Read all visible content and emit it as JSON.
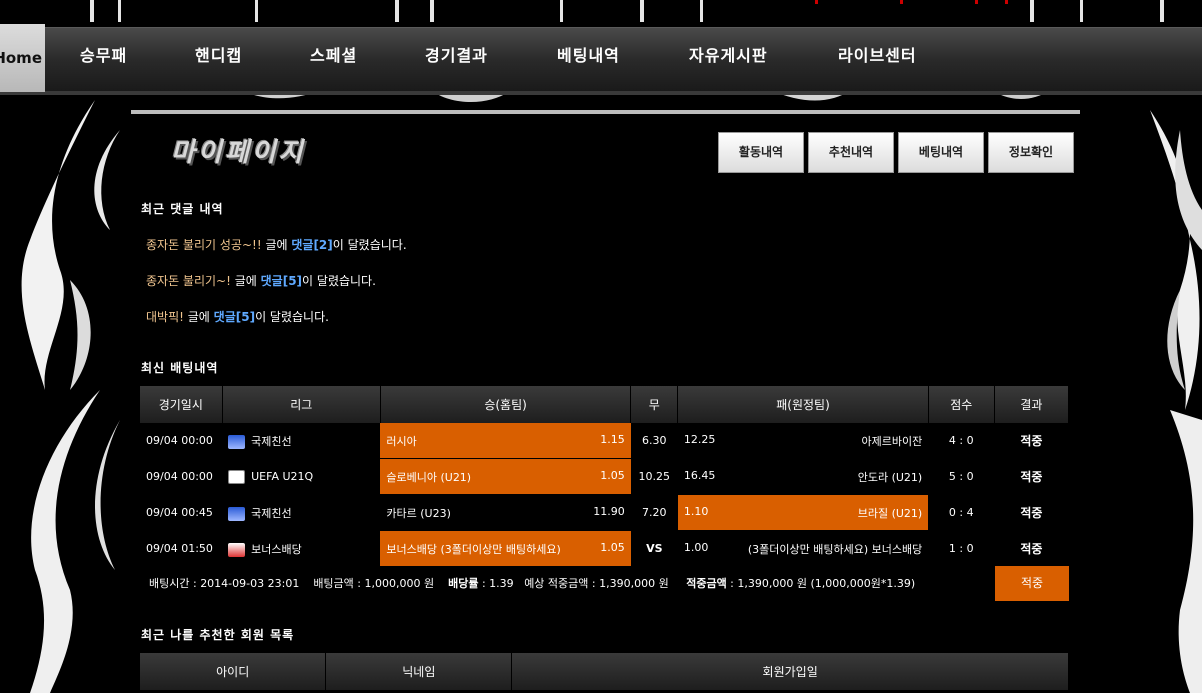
{
  "nav": {
    "home_label": "Home",
    "items": [
      "승무패",
      "핸디캡",
      "스페셜",
      "경기결과",
      "베팅내역",
      "자유게시판",
      "라이브센터"
    ]
  },
  "page": {
    "title": "마이페이지",
    "tabs": [
      "활동내역",
      "추천내역",
      "베팅내역",
      "정보확인"
    ]
  },
  "comments": {
    "heading": "최근 댓글 내역",
    "items": [
      {
        "title": "종자돈 불리기 성공~!!",
        "mid": " 글에 ",
        "count": "댓글[2]",
        "tail": "이 달렸습니다."
      },
      {
        "title": "종자돈 불리기~!",
        "mid": " 글에 ",
        "count": "댓글[5]",
        "tail": "이 달렸습니다."
      },
      {
        "title": "대박픽!",
        "mid": " 글에 ",
        "count": "댓글[5]",
        "tail": "이 달렸습니다."
      }
    ]
  },
  "bets": {
    "heading": "최신 배팅내역",
    "columns": [
      "경기일시",
      "리그",
      "승(홈팀)",
      "무",
      "패(원정팀)",
      "점수",
      "결과"
    ],
    "rows": [
      {
        "date": "09/04 00:00",
        "league": "국제친선",
        "home": "러시아",
        "home_odds": "1.15",
        "draw": "6.30",
        "away_odds": "12.25",
        "away": "아제르바이잔",
        "score": "4 : 0",
        "result": "적중",
        "pick": "home"
      },
      {
        "date": "09/04 00:00",
        "league": "UEFA U21Q",
        "home": "슬로베니아 (U21)",
        "home_odds": "1.05",
        "draw": "10.25",
        "away_odds": "16.45",
        "away": "안도라 (U21)",
        "score": "5 : 0",
        "result": "적중",
        "pick": "home"
      },
      {
        "date": "09/04 00:45",
        "league": "국제친선",
        "home": "카타르 (U23)",
        "home_odds": "11.90",
        "draw": "7.20",
        "away_odds": "1.10",
        "away": "브라질 (U21)",
        "score": "0 : 4",
        "result": "적중",
        "pick": "away"
      },
      {
        "date": "09/04 01:50",
        "league": "보너스배당",
        "home": "보너스배당 (3폴더이상만 배팅하세요)",
        "home_odds": "1.05",
        "draw": "VS",
        "away_odds": "1.00",
        "away": "(3폴더이상만 배팅하세요) 보너스배당",
        "score": "1 : 0",
        "result": "적중",
        "pick": "home"
      }
    ],
    "summary": {
      "time_label": "배팅시간 : ",
      "time": "2014-09-03 23:01",
      "amount_label": "배팅금액 : ",
      "amount": "1,000,000 원",
      "rate_label": "배당률",
      "rate": " : 1.39",
      "expected_label": "예상 적중금액 : ",
      "expected": "1,390,000 원",
      "won_label": "적중금액",
      "won": " : 1,390,000 원 (1,000,000원*1.39)",
      "result": "적중"
    }
  },
  "members": {
    "heading": "최근 나를 추천한 회원 목록",
    "columns": [
      "아이디",
      "닉네임",
      "회원가입일"
    ]
  },
  "colors": {
    "accent": "#d95f00",
    "link": "#5fa9ff",
    "hit": "#f5a25a"
  }
}
